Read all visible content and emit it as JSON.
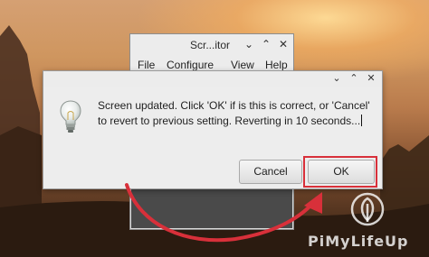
{
  "background_window": {
    "title": "Scr...itor",
    "controls": {
      "minimize": "⌄",
      "maximize": "⌃",
      "close": "✕"
    },
    "menu": [
      "File",
      "Configure",
      "View",
      "Help"
    ]
  },
  "dialog": {
    "controls": {
      "minimize": "⌄",
      "maximize": "⌃",
      "close": "✕"
    },
    "icon": "lightbulb-icon",
    "message": "Screen updated. Click 'OK' if is this is correct, or 'Cancel' to revert to previous setting. Reverting in 10 seconds...",
    "cancel_label": "Cancel",
    "ok_label": "OK"
  },
  "annotation": {
    "highlight_color": "#d8303a",
    "arrow_color": "#d8303a"
  },
  "watermark": {
    "text": "PiMyLifeUp",
    "logo": "leaf-logo-icon"
  }
}
